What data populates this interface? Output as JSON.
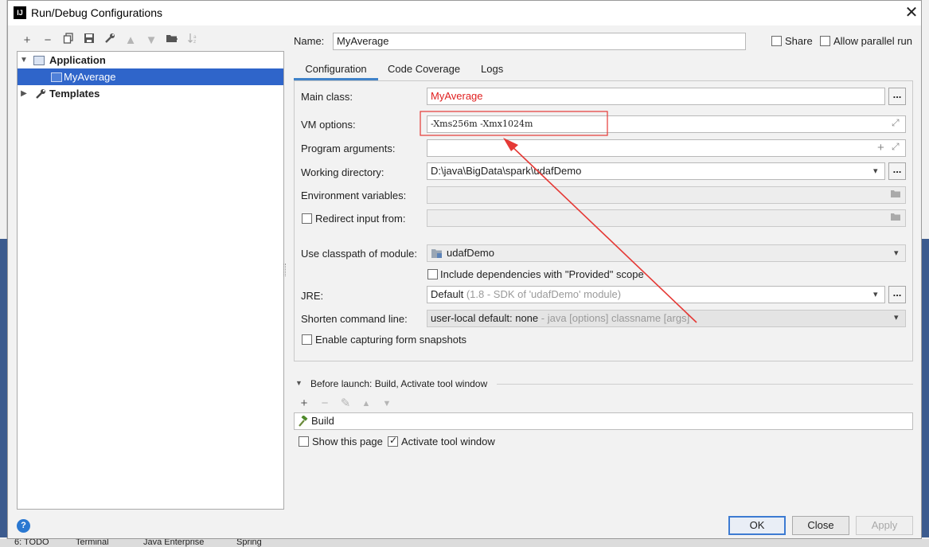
{
  "window": {
    "title": "Run/Debug Configurations",
    "app_icon_text": "IJ"
  },
  "toolbar": {
    "icons": [
      "add-icon",
      "remove-icon",
      "copy-icon",
      "save-icon",
      "wrench-icon",
      "move-up-icon",
      "move-down-icon",
      "folder-icon",
      "sort-icon"
    ]
  },
  "tree": {
    "items": [
      {
        "label": "Application",
        "bold": true,
        "expanded": true
      },
      {
        "label": "MyAverage",
        "selected": true
      },
      {
        "label": "Templates",
        "bold": true,
        "expanded": false
      }
    ]
  },
  "header": {
    "name_label": "Name:",
    "name_value": "MyAverage",
    "share_label": "Share",
    "allow_parallel_label": "Allow parallel run"
  },
  "tabs": [
    {
      "label": "Configuration",
      "active": true
    },
    {
      "label": "Code Coverage",
      "active": false
    },
    {
      "label": "Logs",
      "active": false
    }
  ],
  "config": {
    "main_class_label": "Main class:",
    "main_class_value": "MyAverage",
    "vm_options_label": "VM options:",
    "vm_options_value": "-Xms256m -Xmx1024m",
    "program_args_label": "Program arguments:",
    "program_args_value": "",
    "working_dir_label": "Working directory:",
    "working_dir_value": "D:\\java\\BigData\\spark\\udafDemo",
    "env_vars_label": "Environment variables:",
    "redirect_label": "Redirect input from:",
    "classpath_label": "Use classpath of module:",
    "classpath_value": "udafDemo",
    "include_deps_label": "Include dependencies with \"Provided\" scope",
    "jre_label": "JRE:",
    "jre_value": "Default",
    "jre_detail": "(1.8 - SDK of 'udafDemo' module)",
    "shorten_label": "Shorten command line:",
    "shorten_value": "user-local default: none",
    "shorten_detail": "- java [options] classname [args]",
    "snapshots_label": "Enable capturing form snapshots",
    "dots_label": "..."
  },
  "before_launch": {
    "header": "Before launch: Build, Activate tool window",
    "items": [
      "Build"
    ],
    "show_page_label": "Show this page",
    "show_page_checked": false,
    "activate_label": "Activate tool window",
    "activate_checked": true
  },
  "buttons": {
    "ok": "OK",
    "close": "Close",
    "apply": "Apply",
    "help": "?"
  },
  "background": {
    "bottom_tabs": [
      "6: TODO",
      "Terminal",
      "Java Enterprise",
      "Spring"
    ]
  },
  "colors": {
    "accent": "#2f65ca",
    "error_text": "#e02020",
    "annotation_red": "#e53935"
  }
}
